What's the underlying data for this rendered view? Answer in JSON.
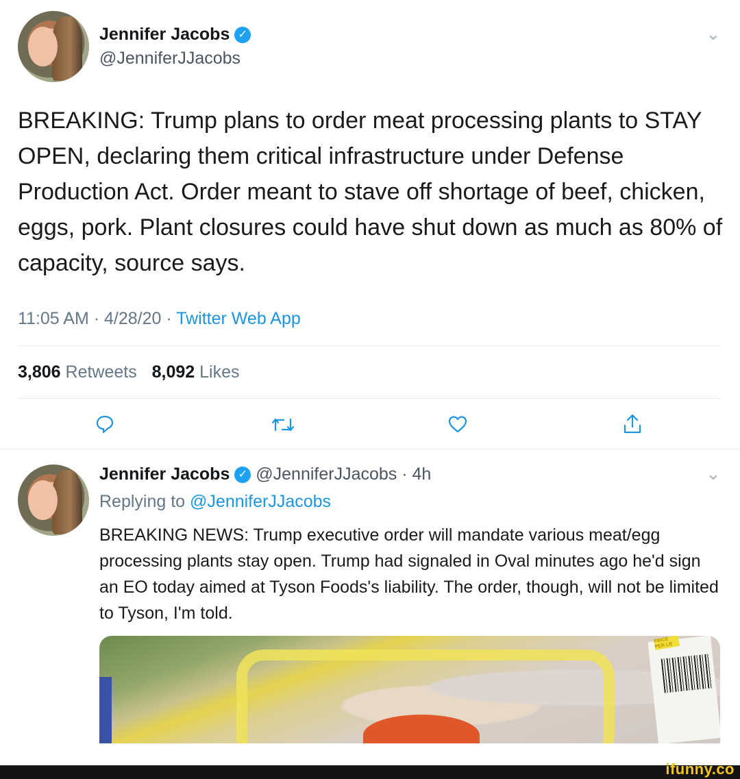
{
  "main_tweet": {
    "author_name": "Jennifer Jacobs",
    "author_handle": "@JenniferJJacobs",
    "text": "BREAKING: Trump plans to order meat processing plants to STAY OPEN, declaring them critical infrastructure under Defense Production Act. Order meant to stave off shortage of beef, chicken, eggs, pork. Plant closures could have shut down as much as 80% of capacity, source says.",
    "time": "11:05 AM",
    "date": "4/28/20",
    "source": "Twitter Web App",
    "retweets_count": "3,806",
    "retweets_label": "Retweets",
    "likes_count": "8,092",
    "likes_label": "Likes"
  },
  "reply_tweet": {
    "author_name": "Jennifer Jacobs",
    "author_handle": "@JenniferJJacobs",
    "age": "4h",
    "replying_prefix": "Replying to",
    "replying_to": "@JenniferJJacobs",
    "text": "BREAKING NEWS: Trump executive order will mandate various meat/egg processing plants stay open. Trump had signaled in Oval minutes ago he'd sign an EO today aimed at Tyson Foods's liability. The order, though, will not be limited to Tyson, I'm told."
  },
  "icons": {
    "verified": "verified-check-icon",
    "menu": "chevron-down-icon",
    "reply": "reply-icon",
    "retweet": "retweet-icon",
    "like": "heart-icon",
    "share": "share-icon"
  },
  "colors": {
    "link": "#1b95e0",
    "verified": "#1da1f2",
    "muted": "#657786",
    "watermark": "#f5c518"
  },
  "photo_label_text": "PRICE PER LB",
  "watermark": "ifunny.co"
}
